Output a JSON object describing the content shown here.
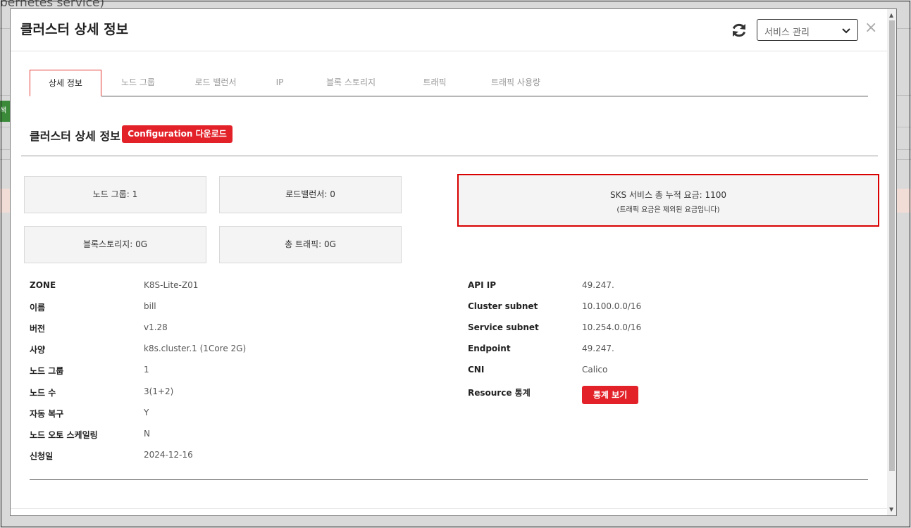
{
  "background": {
    "page_title_partial": "bernetes service)",
    "side_button_partial": "색"
  },
  "modal": {
    "title": "클러스터 상세 정보",
    "service_select": {
      "value": "서비스 관리"
    },
    "close_symbol": "×"
  },
  "tabs": [
    {
      "label": "상세 정보",
      "active": true
    },
    {
      "label": "노드 그룹",
      "active": false
    },
    {
      "label": "로드 밸런서",
      "active": false
    },
    {
      "label": "IP",
      "active": false
    },
    {
      "label": "블록 스토리지",
      "active": false
    },
    {
      "label": "트래픽",
      "active": false
    },
    {
      "label": "트래픽 사용량",
      "active": false
    }
  ],
  "section": {
    "title": "클러스터 상세 정보",
    "config_button": "Configuration 다운로드"
  },
  "stats": {
    "node_groups": "노드 그룹: 1",
    "load_balancers": "로드밸런서: 0",
    "block_storage": "블록스토리지: 0G",
    "total_traffic": "총 트래픽: 0G"
  },
  "fee": {
    "main": "SKS 서비스 총 누적 요금: 1100",
    "note": "(트래픽 요금은 제외된 요금입니다)"
  },
  "details_left": [
    {
      "label": "ZONE",
      "value": "K8S-Lite-Z01"
    },
    {
      "label": "이름",
      "value": "bill"
    },
    {
      "label": "버전",
      "value": "v1.28"
    },
    {
      "label": "사양",
      "value": "k8s.cluster.1 (1Core 2G)"
    },
    {
      "label": "노드 그룹",
      "value": "1"
    },
    {
      "label": "노드 수",
      "value": "3(1+2)"
    },
    {
      "label": "자동 복구",
      "value": "Y"
    },
    {
      "label": "노드 오토 스케일링",
      "value": "N"
    },
    {
      "label": "신청일",
      "value": "2024-12-16"
    }
  ],
  "details_right": [
    {
      "label": "API IP",
      "value": "49.247."
    },
    {
      "label": "Cluster subnet",
      "value": "10.100.0.0/16"
    },
    {
      "label": "Service subnet",
      "value": "10.254.0.0/16"
    },
    {
      "label": "Endpoint",
      "value": "49.247."
    },
    {
      "label": "CNI",
      "value": "Calico"
    },
    {
      "label": "Resource 통계",
      "value": ""
    }
  ],
  "resource_stats_button": "통계 보기",
  "colors": {
    "accent_red": "#e32129",
    "highlight_border": "#d90000"
  }
}
